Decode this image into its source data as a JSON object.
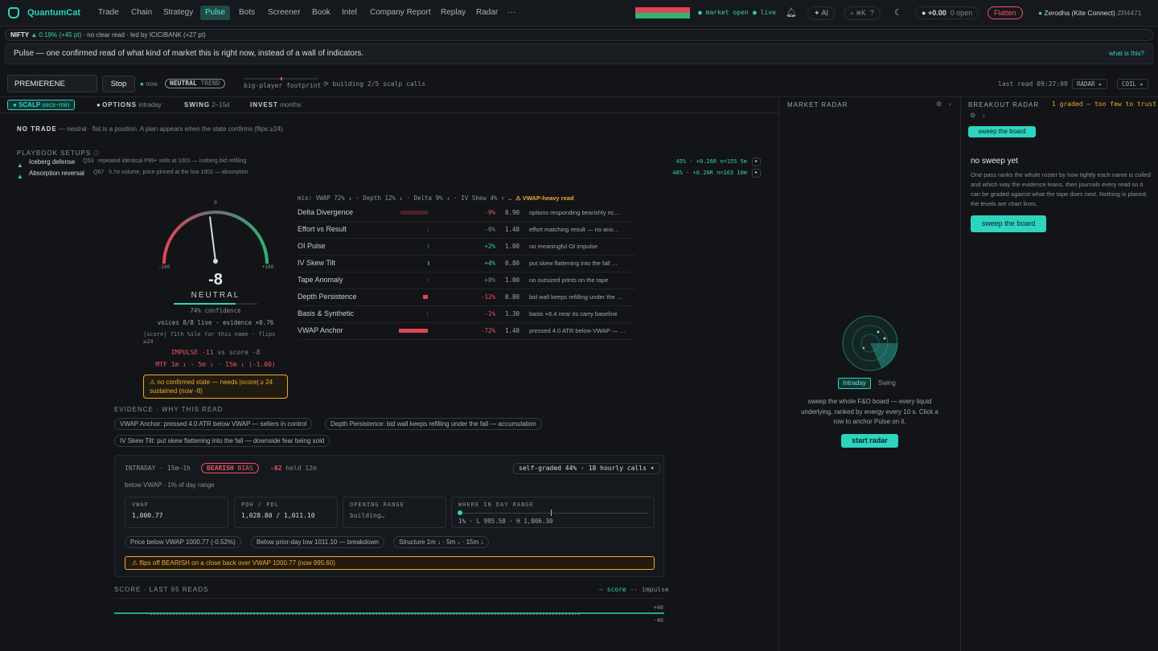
{
  "app": {
    "name": "QuantumCat"
  },
  "nav": {
    "items": [
      "Trade",
      "Chain",
      "Strategy",
      "Pulse",
      "Bots",
      "Screener",
      "Book",
      "Intel",
      "Company Report",
      "Replay",
      "Radar",
      "···"
    ],
    "active": "Pulse"
  },
  "topbar": {
    "market_status": "market open",
    "live": "live",
    "ai": "AI",
    "shortcut": "⌘K",
    "help": "?",
    "pnl": "+0.00",
    "open_count": "0 open",
    "flatten": "Flatten",
    "broker": "Zerodha (Kite Connect)",
    "account": "ZR4471"
  },
  "ticker": {
    "symbol": "NIFTY",
    "change": "▲ 0.19% (+45 pt)",
    "read": "· no clear read",
    "leader": "· led by ICICIBANK (+27 pt)"
  },
  "info": {
    "text": "Pulse — one confirmed read of what kind of market this is right now, instead of a wall of indicators.",
    "link": "what is this?"
  },
  "controls": {
    "symbol_value": "PREMIERENE",
    "stop": "Stop",
    "now": "now",
    "trend_badge_a": "NEUTRAL",
    "trend_badge_b": "TREND",
    "footprint": "big-player footprint",
    "building": "building 2/5 scalp calls",
    "last_read": "last read 09:27:09",
    "radar_btn": "RADAR ▸",
    "coil_btn": "COIL ▸"
  },
  "horizons": [
    {
      "name": "SCALP",
      "sub": "secs–min"
    },
    {
      "name": "OPTIONS",
      "sub": "intraday"
    },
    {
      "name": "SWING",
      "sub": "2–15d"
    },
    {
      "name": "INVEST",
      "sub": "months"
    }
  ],
  "no_trade": {
    "label": "NO TRADE",
    "text": "— neutral · flat is a position. A plan appears when the state confirms (flips ≥24)."
  },
  "playbook": {
    "title": "PLAYBOOK SETUPS",
    "setups": [
      {
        "name": "Iceberg defense",
        "score": "Q53",
        "desc": "repeated identical P99+ sells at 1001 — iceberg bid refilling",
        "stats": "45% · +0.26R n=155 5m"
      },
      {
        "name": "Absorption reversal",
        "score": "Q67",
        "desc": "5.7σ volume, price pinned at the low 1002 — absorption",
        "stats": "48% · +0.20R n=103 10m"
      }
    ]
  },
  "gauge": {
    "top": "0",
    "left": "-100",
    "right": "+100",
    "score": "-8",
    "state": "NEUTRAL",
    "confidence": "74% confidence",
    "voices": "voices 8/8 live · evidence ×0.76",
    "pctile": "|score| 71th %ile for this name · flips ≥24",
    "impulse": "IMPULSE -11",
    "impulse_vs": "vs score -8",
    "mtf": "MTF 1m ↓ · 5m ↓ · 15m ↓ (-1.00)",
    "warning": "⚠ no confirmed state — needs |score| ≥ 24 sustained (now -8)",
    "level": -0.08
  },
  "mix": {
    "line": "mix: VWAP 72% ↓ · Depth 12% ↓ · Delta 9% ↓ · IV Skew 4% ↑ …",
    "warn": "⚠ VWAP-heavy read"
  },
  "signals": [
    {
      "name": "Delta Divergence",
      "pct": "-9%",
      "w": "0.90",
      "desc": "options responding bearishly ric…",
      "v": -0.09
    },
    {
      "name": "Effort vs Result",
      "pct": "-0%",
      "w": "1.40",
      "desc": "effort matching result — no ano…",
      "v": -0.0
    },
    {
      "name": "OI Pulse",
      "pct": "+2%",
      "w": "1.00",
      "desc": "no meaningful OI impulse",
      "v": 0.02
    },
    {
      "name": "IV Skew Tilt",
      "pct": "+4%",
      "w": "0.80",
      "desc": "put skew flattening into the fall …",
      "v": 0.04
    },
    {
      "name": "Tape Anomaly",
      "pct": "+0%",
      "w": "1.00",
      "desc": "no outsized prints on the tape",
      "v": 0.0
    },
    {
      "name": "Depth Persistence",
      "pct": "-12%",
      "w": "0.80",
      "desc": "bid wall keeps refilling under the …",
      "v": -0.12
    },
    {
      "name": "Basis & Synthetic",
      "pct": "-1%",
      "w": "1.30",
      "desc": "basis +6.4 near its carry baseline",
      "v": -0.01
    },
    {
      "name": "VWAP Anchor",
      "pct": "-72%",
      "w": "1.40",
      "desc": "pressed 4.0 ATR below VWAP — …",
      "v": -0.72
    }
  ],
  "evidence": {
    "title": "EVIDENCE · WHY THIS READ",
    "chips": [
      "VWAP Anchor: pressed 4.0 ATR below VWAP — sellers in control",
      "Depth Persistence: bid wall keeps refilling under the fall — accumulation",
      "IV Skew Tilt: put skew flattening into the fall — downside fear being sold"
    ]
  },
  "intraday": {
    "head": "INTRADAY · 15m–1h",
    "bias_a": "BEARISH",
    "bias_b": "BIAS",
    "score": "-82",
    "held": "held 12m",
    "graded": "self-graded 44% · 18 hourly calls ▾",
    "sub": "below VWAP · 1% of day range",
    "vwap_k": "VWAP",
    "vwap_v": "1,000.77",
    "pdh_k": "PDH / PDL",
    "pdh_v": "1,028.80 / 1,011.10",
    "or_k": "OPENING RANGE",
    "or_v": "building…",
    "where_k": "WHERE IN DAY RANGE",
    "where_v": "1% · L 995.50 · H 1,006.30",
    "where_level": 0.01,
    "chips": [
      "Price below VWAP 1000.77 (-0.52%)",
      "Below prior-day low 1011.10 — breakdown",
      "Structure 1m ↓ · 5m ↓ · 15m ↓"
    ],
    "flip": "⚠ flips off BEARISH on a close back over VWAP 1000.77 (now 995.60)"
  },
  "score_panel": {
    "title": "SCORE · LAST 95 READS",
    "legend_a": "— score",
    "legend_b": "-- impulse",
    "top": "+40",
    "bottom": "-40"
  },
  "market_radar": {
    "title": "MARKET RADAR",
    "tab_a": "Intraday",
    "tab_b": "Swing",
    "desc": "sweep the whole F&O board — every liquid underlying, ranked by energy every 10 s. Click a row to anchor Pulse on it.",
    "start": "start radar"
  },
  "breakout": {
    "title": "BREAKOUT RADAR",
    "status": "1 graded — too few to trust",
    "sweep_small": "sweep the board",
    "none": "no sweep yet",
    "desc": "One pass ranks the whole roster by how tightly each name is coiled and which way the evidence leans, then journals every read so it can be graded against what the tape does next. Nothing is placed; the levels are chart lines.",
    "sweep_big": "sweep the board"
  },
  "colors": {
    "accent": "#2dd4bf",
    "bear": "#f05265",
    "bull": "#34d399",
    "warn": "#f0a830"
  }
}
